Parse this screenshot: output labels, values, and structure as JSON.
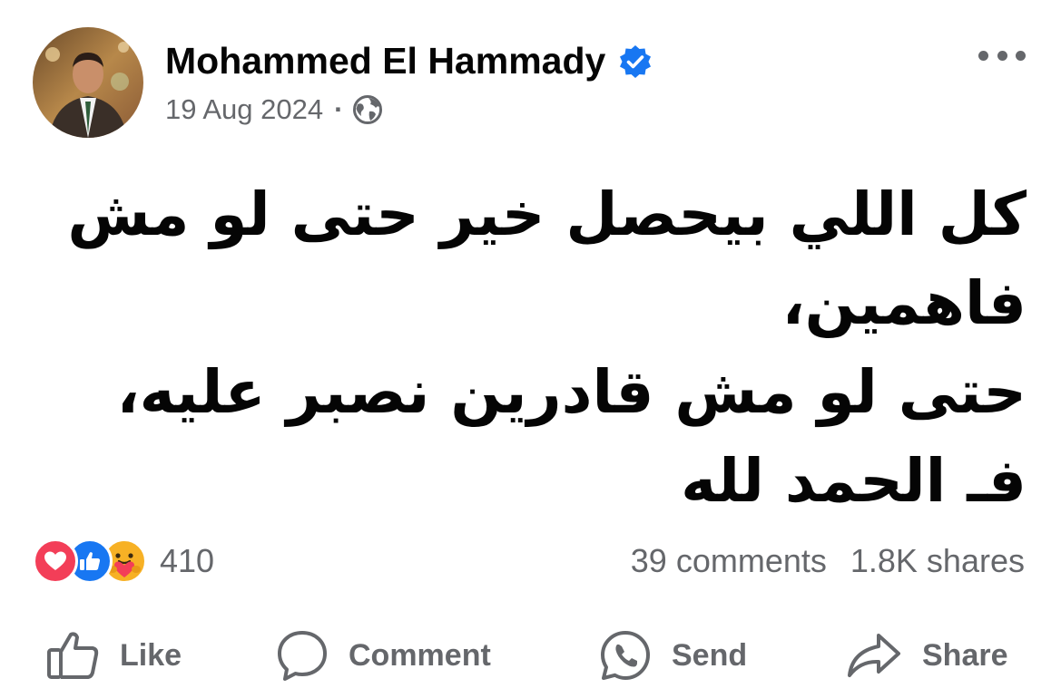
{
  "post": {
    "author": "Mohammed El Hammady",
    "date": "19 Aug 2024",
    "separator": "·",
    "privacy_icon": "globe-icon",
    "verified_icon": "verified-badge-icon",
    "text_lines": [
      "كل اللي بيحصل خير حتى لو مش",
      "فاهمين،",
      "حتى لو مش قادرين نصبر عليه،",
      "فـ الحمد لله"
    ]
  },
  "stats": {
    "reactions_icons": [
      "love-icon",
      "like-icon",
      "care-icon"
    ],
    "reaction_count": "410",
    "comments": "39 comments",
    "shares": "1.8K shares"
  },
  "actions": {
    "like": "Like",
    "comment": "Comment",
    "send": "Send",
    "share": "Share"
  },
  "colors": {
    "text": "#050505",
    "secondary_text": "#65676b",
    "verified": "#1877f2",
    "love": "#f33e58",
    "like": "#1877f2",
    "care": "#f7b125"
  }
}
